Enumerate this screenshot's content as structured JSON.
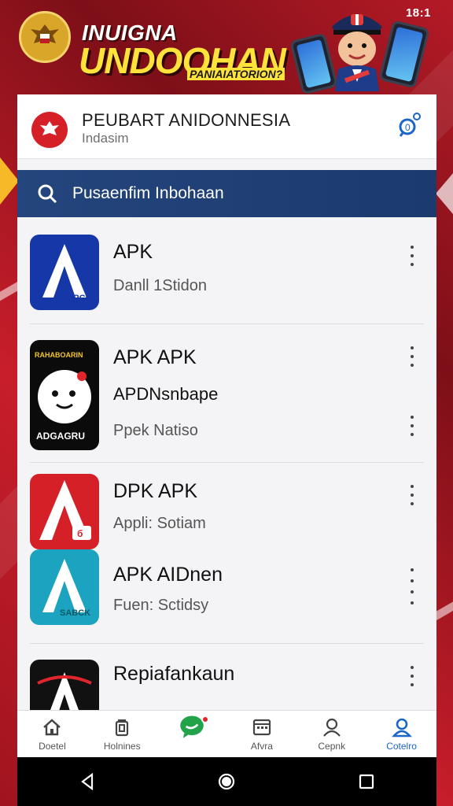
{
  "status_bar": {
    "time": "18:1"
  },
  "banner": {
    "title_line1": "INUIGNA",
    "title_line2": "UNDOOHAN",
    "subtitle": "PANIAIATORION?"
  },
  "brand": {
    "name": "PEUBART ANIDONNESIA",
    "subtitle": "Indasim",
    "icon": "garuda-logo"
  },
  "search": {
    "placeholder": "Pusaenfim Inbohaan",
    "icon": "search-icon"
  },
  "apps": [
    {
      "title": "APK",
      "subtitle": "Danll  1Stidon",
      "icon_label": "SAPCK",
      "icon_bg": "#1637a8"
    },
    {
      "title": "APK APK",
      "subtitle_bold": "APDNsnbape",
      "subtitle": "Ppek  Natiso",
      "icon_top_label": "RAHABOARIN",
      "icon_label": "ADGAGRU",
      "icon_bg": "#0b0b0b"
    },
    {
      "title": "DPK APK",
      "subtitle": "Appli:  Sotiam",
      "icon_bg": "#d52027"
    },
    {
      "title": "APK AIDnen",
      "subtitle": "Fuen:  Sctidsy",
      "icon_label": "SABCK",
      "icon_bg": "#1ba3bf"
    },
    {
      "title": "Repiafankaun",
      "subtitle": "",
      "icon_bg": "#111111"
    }
  ],
  "bottom_nav": [
    {
      "label": "Doetel",
      "icon": "home-icon"
    },
    {
      "label": "Holnines",
      "icon": "trash-icon"
    },
    {
      "label": "",
      "icon": "chat-icon"
    },
    {
      "label": "Afvra",
      "icon": "calendar-icon"
    },
    {
      "label": "Cepnk",
      "icon": "user-icon"
    },
    {
      "label": "Cotelro",
      "icon": "profile-icon"
    }
  ],
  "colors": {
    "accent_blue": "#1b66c9",
    "search_bar": "#24457d",
    "brand_red": "#d52027",
    "banner_yellow": "#ffe23a"
  }
}
